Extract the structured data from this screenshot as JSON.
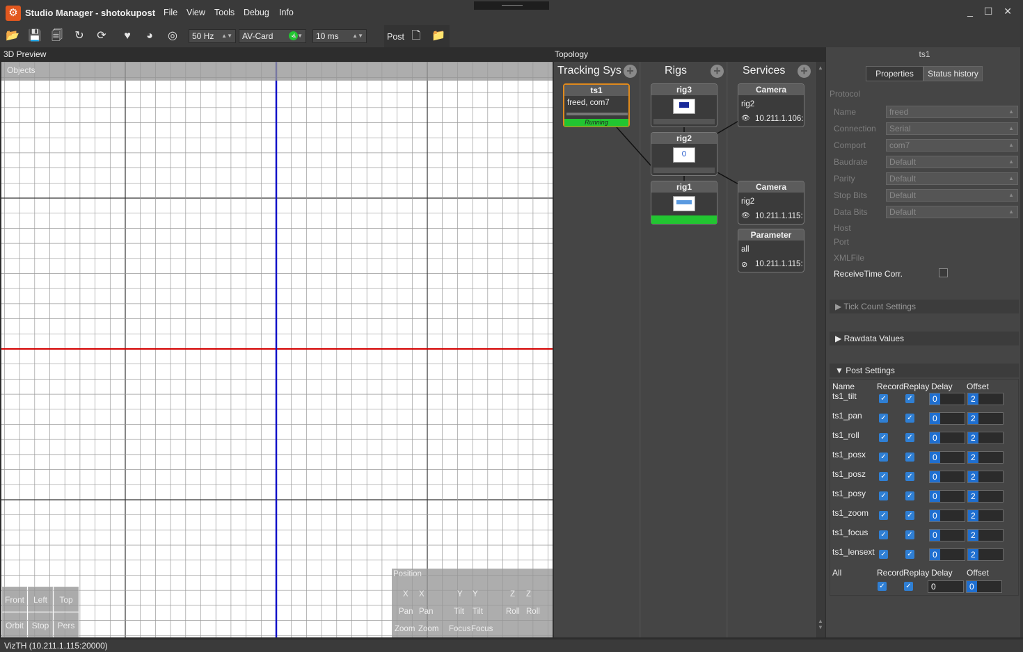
{
  "window": {
    "title": "Studio Manager - shotokupost",
    "controls": "_ ☐ ✕"
  },
  "menu": [
    "File",
    "View",
    "Tools",
    "Debug",
    "Info"
  ],
  "toolbar": {
    "rate": "50 Hz",
    "card": "AV-Card",
    "delay": "10 ms",
    "post_label": "Post"
  },
  "preview": {
    "title": "3D Preview",
    "objects": "Objects",
    "view_buttons": [
      "Front",
      "Left",
      "Top",
      "Orbit",
      "Stop",
      "Pers"
    ],
    "position_panel": {
      "title": "Position",
      "axes": [
        "X",
        "X",
        "Y",
        "Y",
        "Z",
        "Z"
      ],
      "row2": [
        "Pan",
        "Pan",
        "Tilt",
        "Tilt",
        "Roll",
        "Roll"
      ],
      "row3": [
        "Zoom",
        "Zoom",
        "Focus",
        "Focus"
      ]
    }
  },
  "topology": {
    "title": "Topology",
    "columns": [
      "Tracking Sys",
      "Rigs",
      "Services"
    ],
    "tracking": {
      "name": "ts1",
      "detail": "freed,  com7",
      "state": "Running"
    },
    "rigs": [
      "rig3",
      "rig2",
      "rig1"
    ],
    "services": [
      {
        "name": "Camera",
        "rig": "rig2",
        "addr": "10.211.1.106:"
      },
      {
        "name": "Camera",
        "rig": "rig2",
        "addr": "10.211.1.115:"
      },
      {
        "name": "Parameter",
        "rig": "all",
        "addr": "10.211.1.115:"
      }
    ]
  },
  "props": {
    "header": "ts1",
    "tabs": [
      "Properties",
      "Status history"
    ],
    "section": "Protocol",
    "fields": [
      {
        "label": "Name",
        "value": "freed"
      },
      {
        "label": "Connection",
        "value": "Serial"
      },
      {
        "label": "Comport",
        "value": "com7"
      },
      {
        "label": "Baudrate",
        "value": "Default"
      },
      {
        "label": "Parity",
        "value": "Default"
      },
      {
        "label": "Stop Bits",
        "value": "Default"
      },
      {
        "label": "Data Bits",
        "value": "Default"
      }
    ],
    "extra": [
      "Host",
      "Port",
      "XMLFile"
    ],
    "receive": "ReceiveTime Corr.",
    "tick": "Tick Count Settings",
    "rawdata": "Rawdata Values",
    "post": "Post Settings",
    "cols": [
      "Name",
      "Record",
      "Replay",
      "Delay",
      "Offset"
    ],
    "rows": [
      {
        "name": "ts1_tilt",
        "delay": "0",
        "offset": "2"
      },
      {
        "name": "ts1_pan",
        "delay": "0",
        "offset": "2"
      },
      {
        "name": "ts1_roll",
        "delay": "0",
        "offset": "2"
      },
      {
        "name": "ts1_posx",
        "delay": "0",
        "offset": "2"
      },
      {
        "name": "ts1_posz",
        "delay": "0",
        "offset": "2"
      },
      {
        "name": "ts1_posy",
        "delay": "0",
        "offset": "2"
      },
      {
        "name": "ts1_zoom",
        "delay": "0",
        "offset": "2"
      },
      {
        "name": "ts1_focus",
        "delay": "0",
        "offset": "2"
      },
      {
        "name": "ts1_lensext",
        "delay": "0",
        "offset": "2"
      }
    ],
    "all": {
      "name": "All",
      "delay": "0",
      "offset": "0"
    }
  },
  "status": "VizTH (10.211.1.115:20000)",
  "colors": {
    "running": "#22c531",
    "x_axis": "#d40000",
    "y_axis": "#1010c8",
    "accent": "#e2581f"
  }
}
